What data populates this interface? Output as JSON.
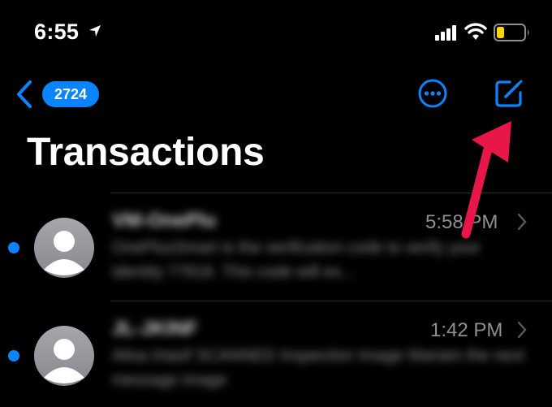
{
  "status_bar": {
    "time": "6:55",
    "icons": [
      "location-arrow-icon",
      "cellular-signal-icon",
      "wifi-icon",
      "battery-low-icon"
    ],
    "battery_color": "#ffd60a"
  },
  "nav": {
    "back_badge": "2724",
    "more_icon": "ellipsis-circle-icon",
    "compose_icon": "compose-icon",
    "accent_color": "#0a84ff"
  },
  "title": "Transactions",
  "messages": [
    {
      "sender": "VM-OnePlu",
      "time": "5:58 PM",
      "preview": "OnePlusSmart is the verification code to verify your identity 77816. This code will ex...",
      "unread": true
    },
    {
      "sender": "JL-JKINF",
      "time": "1:42 PM",
      "preview": "Alisa Irtasif SCANNED Inspection Image Mariam the next message image",
      "unread": true
    }
  ],
  "annotation": {
    "arrow_color": "#e8174a"
  }
}
